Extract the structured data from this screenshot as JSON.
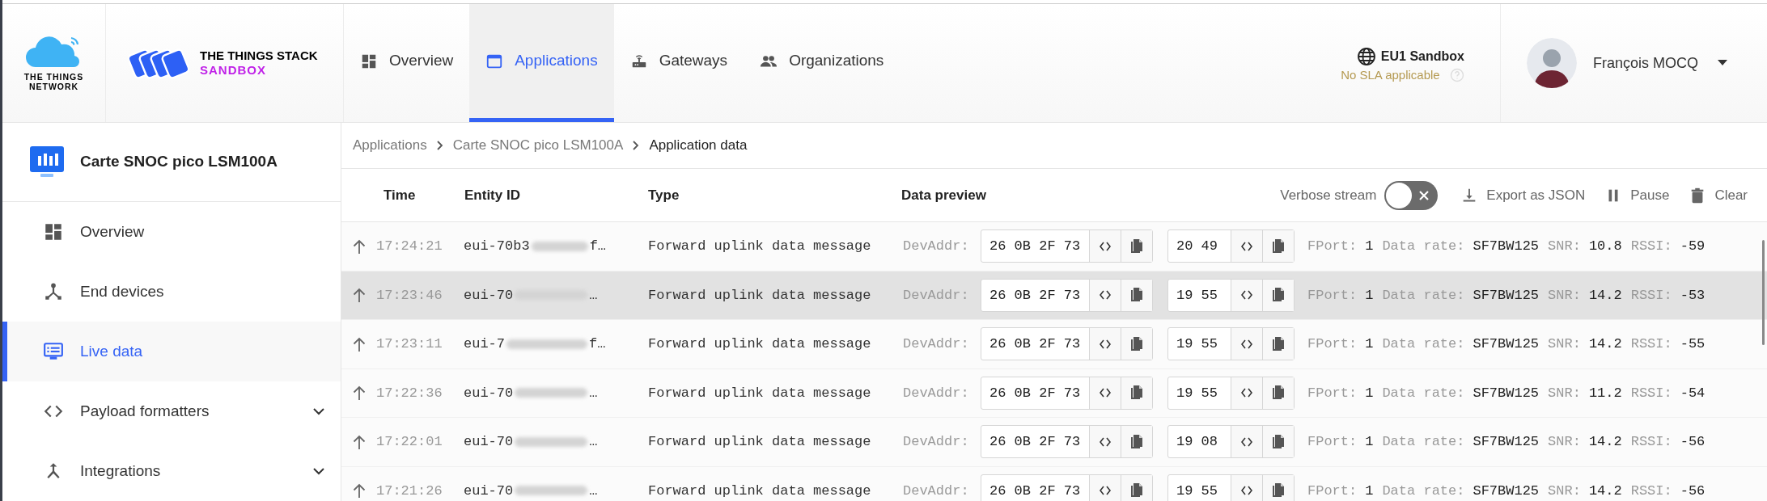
{
  "header": {
    "logo_lines": [
      "THE THINGS",
      "NETWORK"
    ],
    "product_lines": [
      "THE THINGS STACK",
      "SANDBOX"
    ],
    "nav": [
      {
        "label": "Overview",
        "selected": false
      },
      {
        "label": "Applications",
        "selected": true
      },
      {
        "label": "Gateways",
        "selected": false
      },
      {
        "label": "Organizations",
        "selected": false
      }
    ],
    "cluster": {
      "name": "EU1 Sandbox",
      "sla": "No SLA applicable"
    },
    "user": {
      "name": "François MOCQ"
    }
  },
  "sidebar": {
    "app_name": "Carte SNOC pico LSM100A",
    "items": [
      {
        "label": "Overview",
        "selected": false,
        "expandable": false
      },
      {
        "label": "End devices",
        "selected": false,
        "expandable": false
      },
      {
        "label": "Live data",
        "selected": true,
        "expandable": false
      },
      {
        "label": "Payload formatters",
        "selected": false,
        "expandable": true
      },
      {
        "label": "Integrations",
        "selected": false,
        "expandable": true
      }
    ]
  },
  "breadcrumb": [
    "Applications",
    "Carte SNOC pico LSM100A",
    "Application data"
  ],
  "table": {
    "columns": [
      "Time",
      "Entity ID",
      "Type",
      "Data preview"
    ],
    "verbose": {
      "label": "Verbose stream",
      "on": false
    },
    "actions": [
      {
        "label": "Export as JSON"
      },
      {
        "label": "Pause"
      },
      {
        "label": "Clear"
      }
    ],
    "rows": [
      {
        "time": "17:24:21",
        "entity_prefix": "eui-70b3",
        "entity_suffix": "f…",
        "type": "Forward uplink data message",
        "addr_label": "DevAddr:",
        "dev_addr": "26 0B 2F 73",
        "payload": "20 49",
        "hovered": false,
        "fields": [
          {
            "label": "FPort:",
            "value": "1"
          },
          {
            "label": "Data rate:",
            "value": "SF7BW125"
          },
          {
            "label": "SNR:",
            "value": "10.8"
          },
          {
            "label": "RSSI:",
            "value": "-59"
          }
        ]
      },
      {
        "time": "17:23:46",
        "entity_prefix": "eui-70",
        "entity_suffix": "…",
        "type": "Forward uplink data message",
        "addr_label": "DevAddr:",
        "dev_addr": "26 0B 2F 73",
        "payload": "19 55",
        "hovered": true,
        "fields": [
          {
            "label": "FPort:",
            "value": "1"
          },
          {
            "label": "Data rate:",
            "value": "SF7BW125"
          },
          {
            "label": "SNR:",
            "value": "14.2"
          },
          {
            "label": "RSSI:",
            "value": "-53"
          }
        ]
      },
      {
        "time": "17:23:11",
        "entity_prefix": "eui-7",
        "entity_suffix": "f…",
        "type": "Forward uplink data message",
        "addr_label": "DevAddr:",
        "dev_addr": "26 0B 2F 73",
        "payload": "19 55",
        "hovered": false,
        "fields": [
          {
            "label": "FPort:",
            "value": "1"
          },
          {
            "label": "Data rate:",
            "value": "SF7BW125"
          },
          {
            "label": "SNR:",
            "value": "14.2"
          },
          {
            "label": "RSSI:",
            "value": "-55"
          }
        ]
      },
      {
        "time": "17:22:36",
        "entity_prefix": "eui-70",
        "entity_suffix": "…",
        "type": "Forward uplink data message",
        "addr_label": "DevAddr:",
        "dev_addr": "26 0B 2F 73",
        "payload": "19 55",
        "hovered": false,
        "fields": [
          {
            "label": "FPort:",
            "value": "1"
          },
          {
            "label": "Data rate:",
            "value": "SF7BW125"
          },
          {
            "label": "SNR:",
            "value": "11.2"
          },
          {
            "label": "RSSI:",
            "value": "-54"
          }
        ]
      },
      {
        "time": "17:22:01",
        "entity_prefix": "eui-70",
        "entity_suffix": "…",
        "type": "Forward uplink data message",
        "addr_label": "DevAddr:",
        "dev_addr": "26 0B 2F 73",
        "payload": "19 08",
        "hovered": false,
        "fields": [
          {
            "label": "FPort:",
            "value": "1"
          },
          {
            "label": "Data rate:",
            "value": "SF7BW125"
          },
          {
            "label": "SNR:",
            "value": "14.2"
          },
          {
            "label": "RSSI:",
            "value": "-56"
          }
        ]
      },
      {
        "time": "17:21:26",
        "entity_prefix": "eui-70",
        "entity_suffix": "…",
        "type": "Forward uplink data message",
        "addr_label": "DevAddr:",
        "dev_addr": "26 0B 2F 73",
        "payload": "19 55",
        "hovered": false,
        "fields": [
          {
            "label": "FPort:",
            "value": "1"
          },
          {
            "label": "Data rate:",
            "value": "SF7BW125"
          },
          {
            "label": "SNR:",
            "value": "14.2"
          },
          {
            "label": "RSSI:",
            "value": "-56"
          }
        ]
      }
    ]
  }
}
